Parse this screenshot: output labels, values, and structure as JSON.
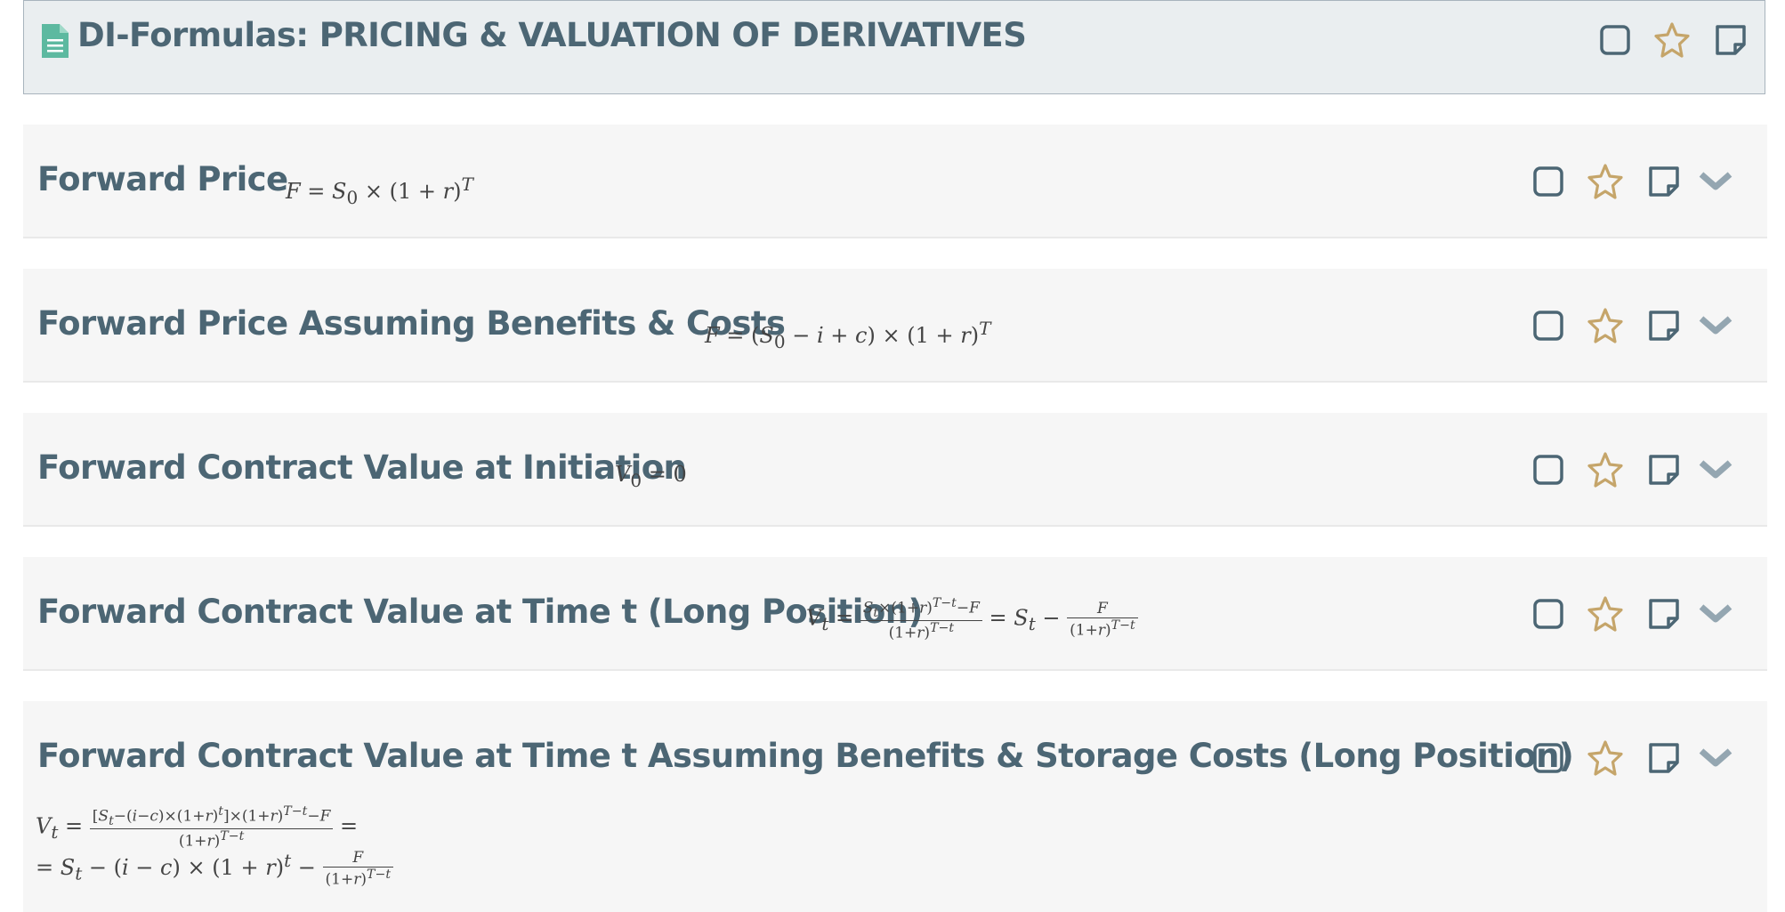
{
  "header": {
    "title": "DI-Formulas: PRICING & VALUATION OF DERIVATIVES",
    "icons": [
      "document-icon",
      "checkbox-icon",
      "star-icon",
      "note-icon"
    ]
  },
  "cards": [
    {
      "title": "Forward Price",
      "formula_text": "F = S0 × (1 + r)^T"
    },
    {
      "title": "Forward Price Assuming Benefits & Costs",
      "formula_text": "F = (S0 − i + c) × (1 + r)^T"
    },
    {
      "title": "Forward Contract Value at Initiation",
      "formula_text": "V0 = 0"
    },
    {
      "title": "Forward Contract Value at Time t (Long Position)",
      "formula_text": "Vt = [St×(1+r)^(T−t) − F] / (1+r)^(T−t) = St − F / (1+r)^(T−t)"
    },
    {
      "title": "Forward Contract Value at Time t Assuming Benefits & Storage Costs (Long Position)",
      "formula_text": "Vt = [[St−(i−c)×(1+r)^t]×(1+r)^(T−t) − F] / (1+r)^(T−t) = St − (i − c) × (1 + r)^t − F / (1+r)^(T−t)"
    }
  ],
  "card_icons": [
    "checkbox-icon",
    "star-icon",
    "note-icon",
    "chevron-down-icon"
  ],
  "colors": {
    "title": "#4c6674",
    "icon_slate": "#4c6674",
    "star": "#c5a56a",
    "chevron": "#94a6b1",
    "doc_icon": "#5db9a0",
    "header_bg": "#eaeef0",
    "card_bg": "#f6f6f6"
  }
}
